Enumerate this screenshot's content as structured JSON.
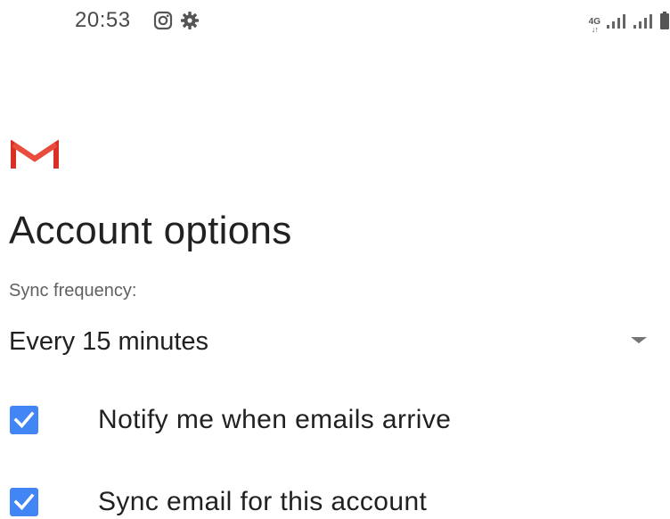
{
  "status_bar": {
    "time": "20:53",
    "left_icons": [
      "instagram-icon",
      "gear-icon"
    ],
    "network_type": "4G",
    "right_icons": [
      "signal-bars-icon",
      "signal-bars-icon",
      "battery-icon"
    ]
  },
  "header": {
    "logo": "gmail-logo"
  },
  "page": {
    "title": "Account options",
    "sync_frequency_label": "Sync frequency:",
    "sync_frequency_value": "Every 15 minutes"
  },
  "options": [
    {
      "label": "Notify me when emails arrive",
      "checked": true
    },
    {
      "label": "Sync email for this account",
      "checked": true
    }
  ],
  "colors": {
    "checkbox": "#4285f4",
    "gmail_red": "#d93025",
    "text_primary": "#212121",
    "text_secondary": "#616161"
  }
}
